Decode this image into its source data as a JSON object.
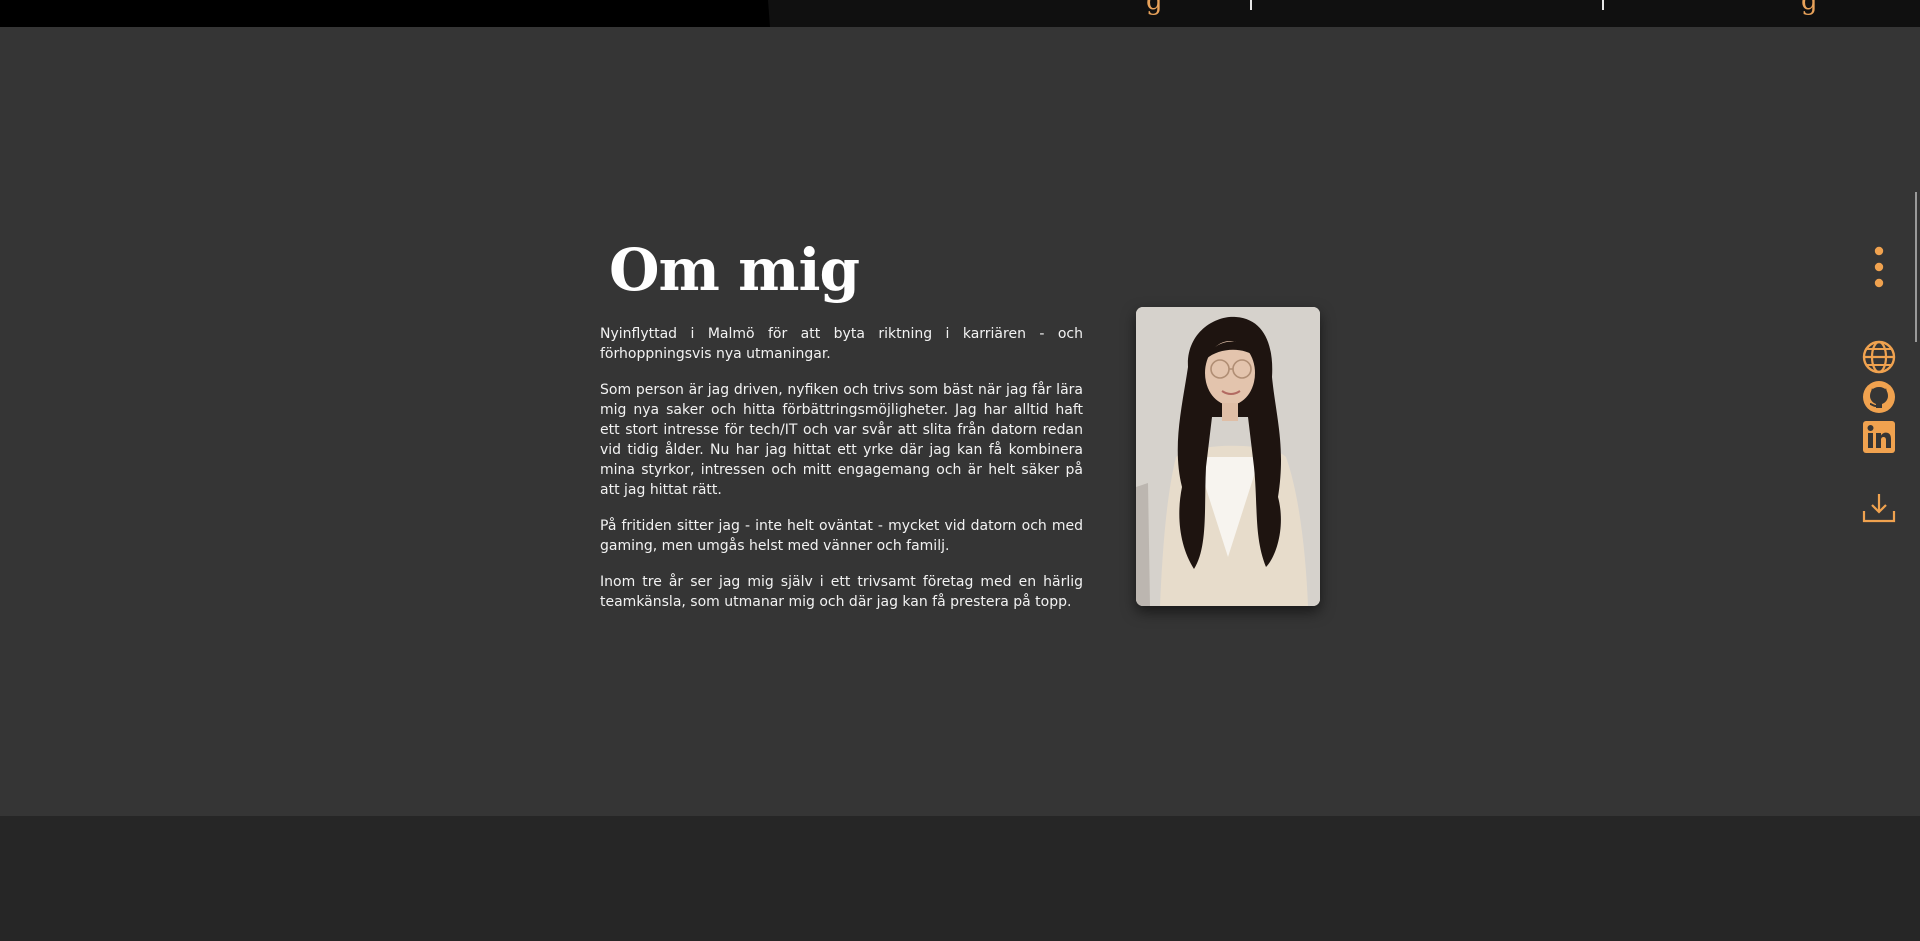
{
  "topnav": {
    "glyph_1": "g",
    "glyph_2": "g"
  },
  "about": {
    "title": "Om mig",
    "paragraphs": [
      "Nyinflyttad i Malmö för att byta riktning i karriären - och förhoppningsvis nya utmaningar.",
      "Som person är jag driven, nyfiken och trivs som bäst när jag får lära mig nya saker och hitta förbättringsmöjligheter. Jag har alltid haft ett stort intresse för tech/IT och var svår att slita från datorn redan vid tidig ålder. Nu har jag hittat ett yrke där jag kan få kombinera mina styrkor, intressen och mitt engagemang och är helt säker på att jag hittat rätt.",
      "På fritiden sitter jag - inte helt oväntat - mycket vid datorn och med gaming, men umgås helst med vänner och familj.",
      "Inom tre år ser jag mig själv i ett trivsamt företag med en härlig teamkänsla, som utmanar mig och där jag kan få prestera på topp."
    ]
  },
  "sidebar": {
    "icons": [
      "kebab-menu-icon",
      "globe-icon",
      "github-icon",
      "linkedin-icon",
      "download-icon"
    ],
    "accent": "#f0a24f"
  },
  "colors": {
    "background": "#353535",
    "footer": "#262626",
    "topbar": "#000000",
    "accent": "#f0a24f",
    "text": "#f2f2f2"
  }
}
